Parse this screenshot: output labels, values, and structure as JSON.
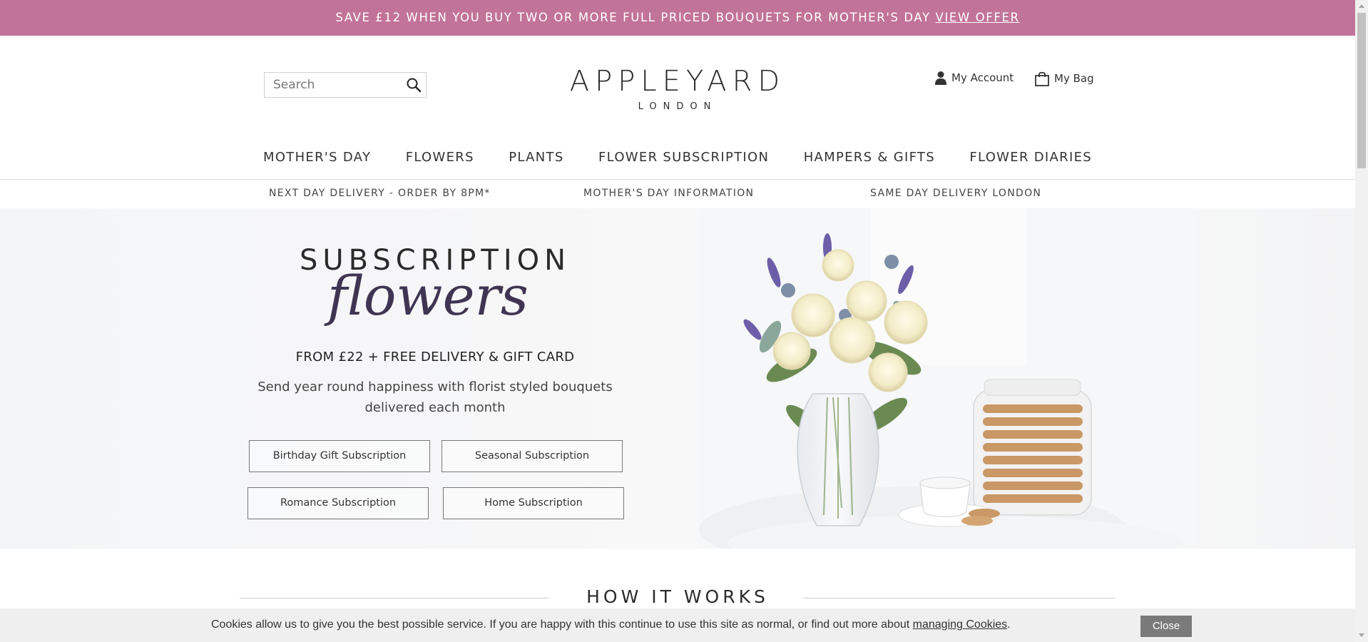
{
  "promo": {
    "text": "SAVE £12 WHEN YOU BUY TWO OR MORE FULL PRICED BOUQUETS FOR MOTHER'S DAY",
    "link": "VIEW OFFER"
  },
  "header": {
    "search_placeholder": "Search",
    "logo_name": "APPLEYARD",
    "logo_city": "LONDON",
    "account_label": "My Account",
    "bag_label": "My Bag"
  },
  "nav": {
    "items": [
      "MOTHER'S DAY",
      "FLOWERS",
      "PLANTS",
      "FLOWER SUBSCRIPTION",
      "HAMPERS & GIFTS",
      "FLOWER DIARIES"
    ]
  },
  "subnav": {
    "items": [
      "NEXT DAY DELIVERY - ORDER BY 8PM*",
      "MOTHER'S DAY INFORMATION",
      "SAME DAY DELIVERY LONDON"
    ]
  },
  "hero": {
    "title": "SUBSCRIPTION",
    "script": "flowers",
    "price": "FROM £22 + FREE DELIVERY & GIFT CARD",
    "desc_line1": "Send year round happiness with florist styled bouquets",
    "desc_line2": "delivered each month",
    "buttons": [
      "Birthday Gift Subscription",
      "Seasonal Subscription",
      "Romance Subscription",
      "Home Subscription"
    ]
  },
  "section": {
    "title": "HOW IT WORKS"
  },
  "cookie": {
    "message": "Cookies allow us to give you the best possible service. If you are happy with this continue to use this site as normal, or find out more about",
    "link": "managing Cookies",
    "period": ".",
    "close": "Close"
  },
  "colors": {
    "promo_bg": "#c27399",
    "script_text": "#3f3553",
    "cookie_close_bg": "#7a7a7a"
  }
}
